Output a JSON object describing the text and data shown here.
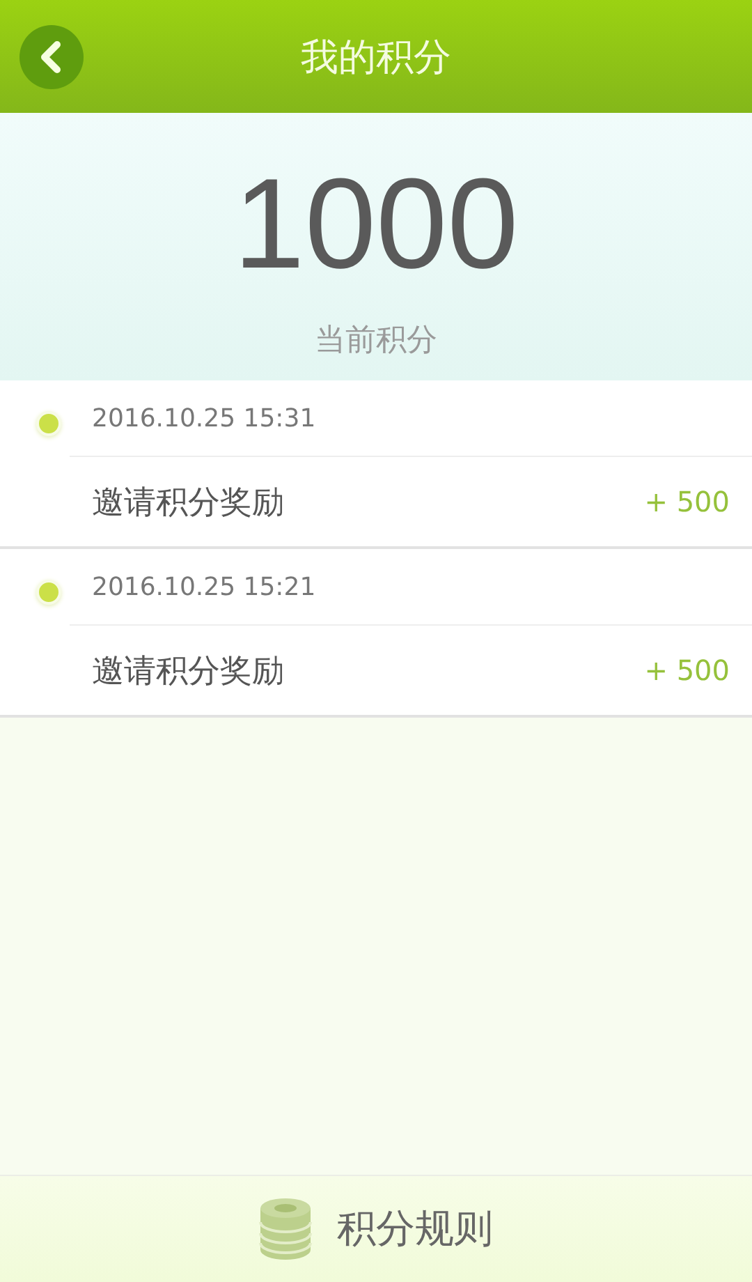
{
  "header": {
    "title": "我的积分"
  },
  "summary": {
    "points": "1000",
    "label": "当前积分"
  },
  "records": [
    {
      "time": "2016.10.25 15:31",
      "title": "邀请积分奖励",
      "amount": "+ 500"
    },
    {
      "time": "2016.10.25 15:21",
      "title": "邀请积分奖励",
      "amount": "+ 500"
    }
  ],
  "footer": {
    "label": "积分规则"
  }
}
